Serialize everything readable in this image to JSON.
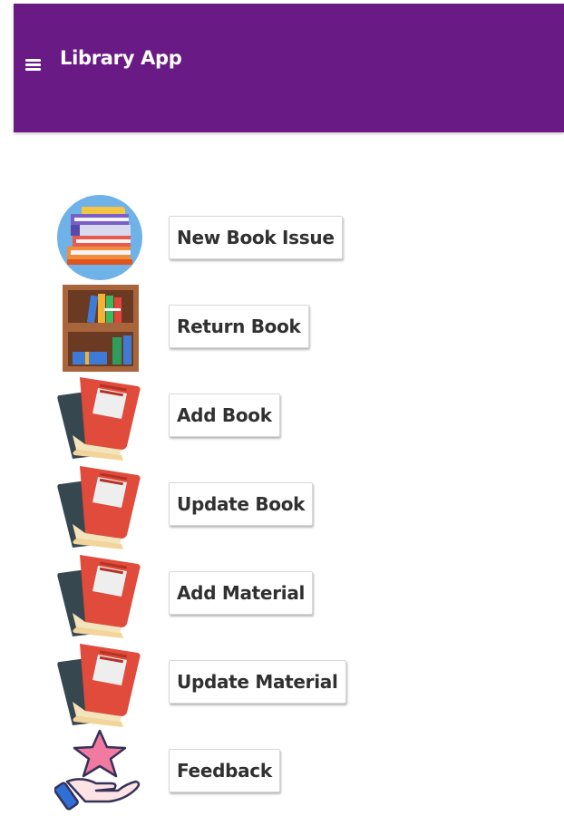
{
  "app_bar": {
    "title": "Library App",
    "background_color": "#6a1a84",
    "menu_icon": "hamburger-menu-icon"
  },
  "menu_items": [
    {
      "label": "New Book Issue",
      "icon": "book-stack-icon"
    },
    {
      "label": "Return Book",
      "icon": "bookshelf-icon"
    },
    {
      "label": "Add Book",
      "icon": "red-book-icon"
    },
    {
      "label": "Update Book",
      "icon": "red-book-icon"
    },
    {
      "label": "Add Material",
      "icon": "red-book-icon"
    },
    {
      "label": "Update Material",
      "icon": "red-book-icon"
    },
    {
      "label": "Feedback",
      "icon": "star-hand-icon"
    }
  ]
}
